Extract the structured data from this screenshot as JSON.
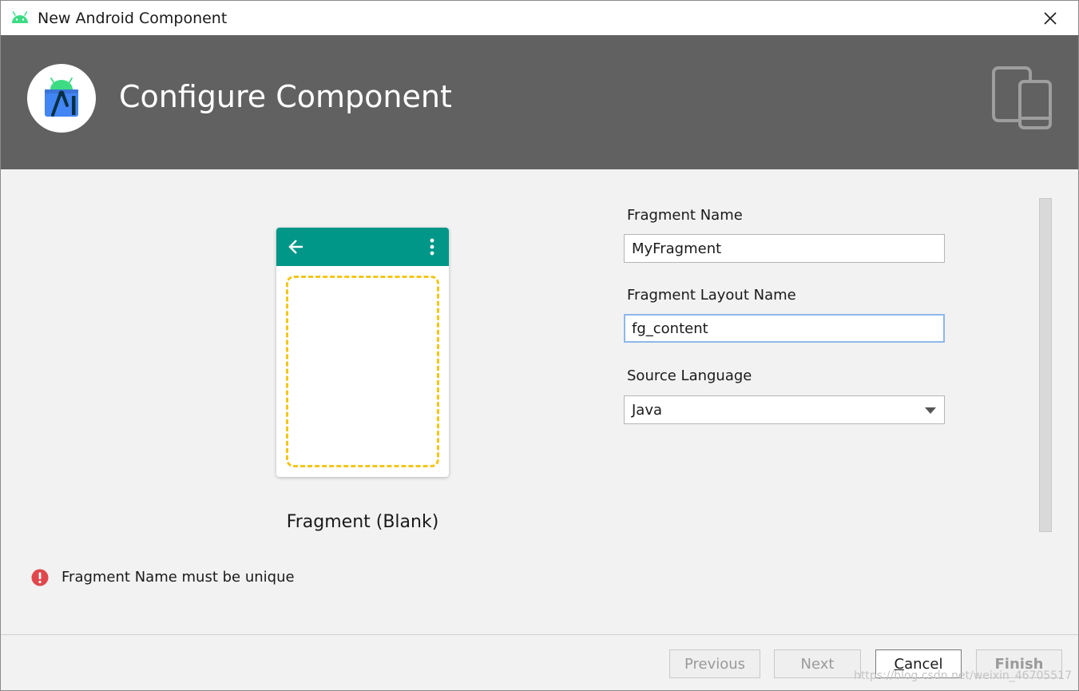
{
  "window": {
    "title": "New Android Component"
  },
  "header": {
    "title": "Configure Component"
  },
  "preview": {
    "template_name": "Fragment (Blank)",
    "toolbar_color": "#009688",
    "frame_color": "#f5c518"
  },
  "form": {
    "fragment_name": {
      "label": "Fragment Name",
      "value": "MyFragment"
    },
    "layout_name": {
      "label": "Fragment Layout Name",
      "value": "fg_content"
    },
    "source_language": {
      "label": "Source Language",
      "value": "Java"
    }
  },
  "validation": {
    "message": "Fragment Name must be unique",
    "icon": "error-icon",
    "color": "#e0474c"
  },
  "buttons": {
    "previous": "Previous",
    "next": "Next",
    "cancel_mnemonic": "C",
    "cancel_rest": "ancel",
    "finish": "Finish"
  },
  "watermark": "https://blog.csdn.net/weixin_46705517",
  "colors": {
    "header_bg": "#616161",
    "android_green": "#3ddc84",
    "studio_blue": "#4285f4"
  }
}
